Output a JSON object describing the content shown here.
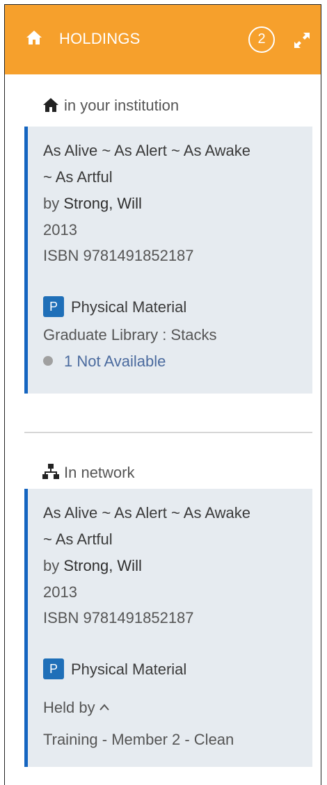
{
  "header": {
    "title": "HOLDINGS",
    "count": "2",
    "bg_color": "#f6a02c"
  },
  "sections": [
    {
      "label": "in your institution",
      "icon": "home-icon",
      "title_line1": "As Alive ~ As Alert ~ As Awake",
      "title_line2": "~ As Artful",
      "by_prefix": "by",
      "author": "Strong, Will",
      "year": "2013",
      "isbn": "ISBN 9781491852187",
      "material_badge": "P",
      "material": "Physical Material",
      "location": "Graduate Library : Stacks",
      "availability": "1 Not Available"
    },
    {
      "label": "In network",
      "icon": "network-icon",
      "title_line1": "As Alive ~ As Alert ~ As Awake",
      "title_line2": "~ As Artful",
      "by_prefix": "by",
      "author": "Strong, Will",
      "year": "2013",
      "isbn": "ISBN 9781491852187",
      "material_badge": "P",
      "material": "Physical Material",
      "held_by": "Held by",
      "member": "Training - Member 2 - Clean"
    }
  ],
  "accent_color": "#1565c0"
}
